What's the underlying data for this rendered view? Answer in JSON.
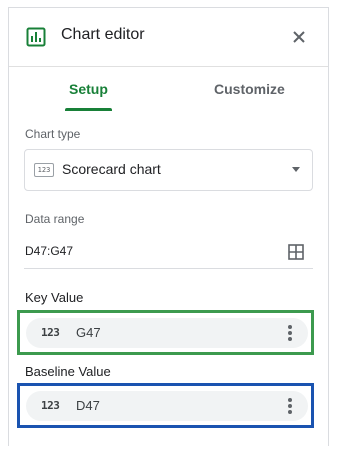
{
  "header": {
    "title": "Chart editor",
    "icon": "chart-icon",
    "close_icon": "close-icon"
  },
  "tabs": [
    {
      "label": "Setup",
      "active": true
    },
    {
      "label": "Customize",
      "active": false
    }
  ],
  "chart_type": {
    "label": "Chart type",
    "icon_text": "123",
    "value": "Scorecard chart"
  },
  "data_range": {
    "label": "Data range",
    "value": "D47:G47",
    "icon": "grid-select-icon"
  },
  "key_value": {
    "title": "Key Value",
    "chip_icon": "123",
    "chip_value": "G47",
    "highlight_color": "#3c9a4e"
  },
  "baseline_value": {
    "title": "Baseline Value",
    "chip_icon": "123",
    "chip_value": "D47",
    "highlight_color": "#1a53b0"
  },
  "colors": {
    "accent": "#188038",
    "chip_bg": "#f1f3f4"
  }
}
